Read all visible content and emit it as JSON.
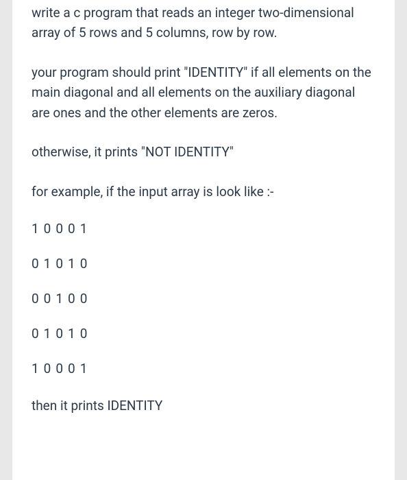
{
  "paragraphs": {
    "p1": "write a c program that reads an integer two-dimensional array of 5 rows and 5 columns, row by row.",
    "p2": "your program should print \"IDENTITY\" if all elements on the main diagonal and all elements on the auxiliary diagonal are ones and the other elements are zeros.",
    "p3": "otherwise, it prints \"NOT IDENTITY\"",
    "p4": "for example, if the input array is look like :-",
    "p5": "then it prints IDENTITY"
  },
  "matrix": {
    "r0": "10001",
    "r1": "01010",
    "r2": "00100",
    "r3": "01010",
    "r4": "10001"
  }
}
